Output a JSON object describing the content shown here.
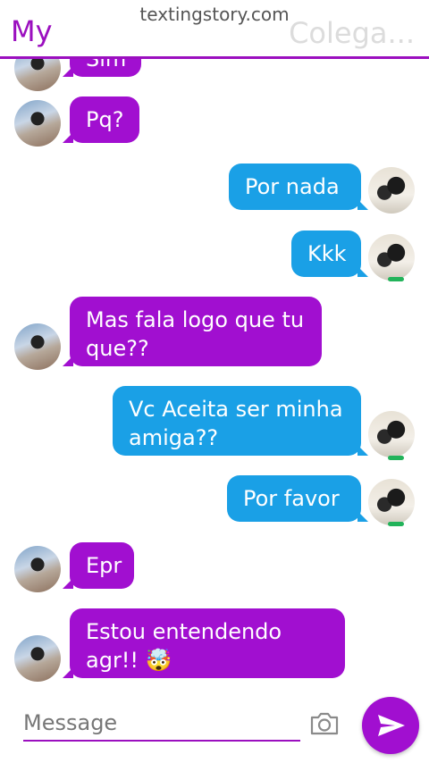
{
  "header": {
    "left_title": "My",
    "watermark": "textingstory.com",
    "right_title": "Colega..."
  },
  "messages": [
    {
      "side": "in",
      "text": "Sim"
    },
    {
      "side": "in",
      "text": "Pq?"
    },
    {
      "side": "out",
      "text": "Por nada"
    },
    {
      "side": "out",
      "text": "Kkk"
    },
    {
      "side": "in",
      "text": "Mas fala logo que tu que??"
    },
    {
      "side": "out",
      "text": "Vc Aceita ser minha amiga??"
    },
    {
      "side": "out",
      "text": "Por favor"
    },
    {
      "side": "in",
      "text": "Epr"
    },
    {
      "side": "in",
      "text": "Estou entendendo agr!! 🤯"
    }
  ],
  "composer": {
    "placeholder": "Message",
    "camera_icon": "camera-icon",
    "send_icon": "send-icon"
  },
  "colors": {
    "accent": "#9b0fbf",
    "incoming_bubble": "#a10fd0",
    "outgoing_bubble": "#1aa0e6"
  }
}
